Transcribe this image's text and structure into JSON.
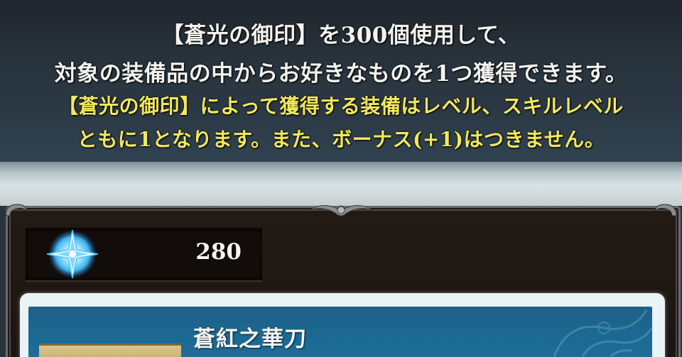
{
  "banner": {
    "line1": "【蒼光の御印】を300個使用して、",
    "line2": "対象の装備品の中からお好きなものを1つ獲得できます。",
    "note1": "【蒼光の御印】によって獲得する装備はレベル、スキルレベル",
    "note2": "ともに1となります。また、ボーナス(+1)はつきません。"
  },
  "currency": {
    "icon": "blue-crystal-icon",
    "count": "280"
  },
  "item": {
    "name": "蒼紅之華刀"
  },
  "colors": {
    "note_text": "#f2e85c",
    "card_blue": "#1b6a94"
  }
}
